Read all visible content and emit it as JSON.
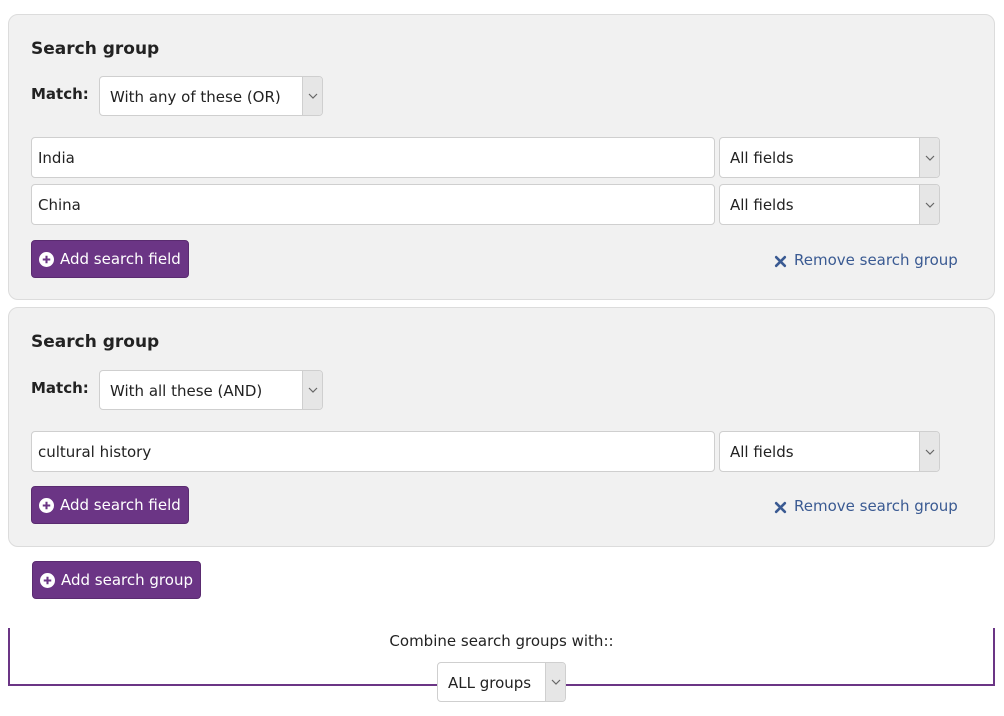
{
  "groups": [
    {
      "title": "Search group",
      "match_label": "Match:",
      "match_value": "With any of these (OR)",
      "fields": [
        {
          "value": "India",
          "scope": "All fields"
        },
        {
          "value": "China",
          "scope": "All fields"
        }
      ],
      "add_field_label": "Add search field",
      "remove_label": "Remove search group"
    },
    {
      "title": "Search group",
      "match_label": "Match:",
      "match_value": "With all these (AND)",
      "fields": [
        {
          "value": "cultural history",
          "scope": "All fields"
        }
      ],
      "add_field_label": "Add search field",
      "remove_label": "Remove search group"
    }
  ],
  "add_group_label": "Add search group",
  "combine": {
    "label": "Combine search groups with::",
    "value": "ALL groups"
  },
  "icons": {
    "add": "plus-circle-icon",
    "remove": "close-icon",
    "dropdown": "chevron-down-icon"
  },
  "colors": {
    "accent": "#6b3585",
    "link": "#3a5a92",
    "panel": "#f1f1f1"
  }
}
